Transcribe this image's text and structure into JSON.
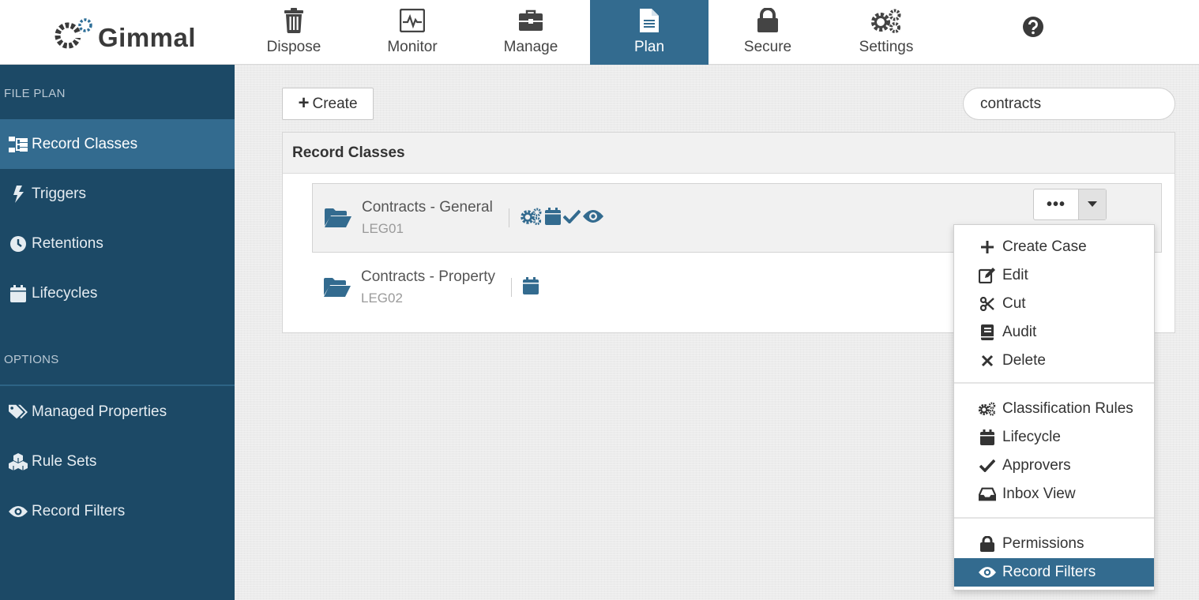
{
  "header": {
    "logo_text": "Gimmal",
    "nav": [
      {
        "label": "Dispose",
        "icon": "trash-icon"
      },
      {
        "label": "Monitor",
        "icon": "monitor-icon"
      },
      {
        "label": "Manage",
        "icon": "briefcase-icon"
      },
      {
        "label": "Plan",
        "icon": "document-icon",
        "active": true
      },
      {
        "label": "Secure",
        "icon": "lock-icon"
      },
      {
        "label": "Settings",
        "icon": "cogs-icon"
      }
    ],
    "help_icon": "question-circle-icon"
  },
  "sidebar": {
    "file_plan_heading": "FILE PLAN",
    "options_heading": "OPTIONS",
    "items": [
      {
        "label": "Record Classes",
        "icon": "sitemap-icon",
        "active": true
      },
      {
        "label": "Triggers",
        "icon": "bolt-icon"
      },
      {
        "label": "Retentions",
        "icon": "clock-icon"
      },
      {
        "label": "Lifecycles",
        "icon": "calendar-icon"
      }
    ],
    "option_items": [
      {
        "label": "Managed Properties",
        "icon": "tags-icon"
      },
      {
        "label": "Rule Sets",
        "icon": "cubes-icon"
      },
      {
        "label": "Record Filters",
        "icon": "eye-icon"
      }
    ]
  },
  "toolbar": {
    "create_label": "Create",
    "search_value": "contracts"
  },
  "panel": {
    "title": "Record Classes",
    "rows": [
      {
        "name": "Contracts - General",
        "code": "LEG01",
        "badges": [
          "cogs-icon",
          "calendar-icon",
          "check-icon",
          "eye-icon"
        ]
      },
      {
        "name": "Contracts - Property",
        "code": "LEG02",
        "badges": [
          "calendar-icon"
        ]
      }
    ]
  },
  "actions_button": {
    "label": "•••"
  },
  "dropdown": {
    "items": [
      {
        "label": "Create Case",
        "icon": "plus-icon"
      },
      {
        "label": "Edit",
        "icon": "edit-icon"
      },
      {
        "label": "Cut",
        "icon": "scissors-icon"
      },
      {
        "label": "Audit",
        "icon": "book-icon"
      },
      {
        "label": "Delete",
        "icon": "times-icon"
      },
      {
        "label": "Classification Rules",
        "icon": "cogs-icon"
      },
      {
        "label": "Lifecycle",
        "icon": "calendar-icon"
      },
      {
        "label": "Approvers",
        "icon": "check-icon"
      },
      {
        "label": "Inbox View",
        "icon": "inbox-icon"
      },
      {
        "label": "Permissions",
        "icon": "lock-icon"
      },
      {
        "label": "Record Filters",
        "icon": "eye-icon",
        "active": true
      }
    ]
  },
  "colors": {
    "accent": "#336b8f",
    "sidebar_bg": "#1c4966",
    "icon_blue": "#336b8f"
  }
}
